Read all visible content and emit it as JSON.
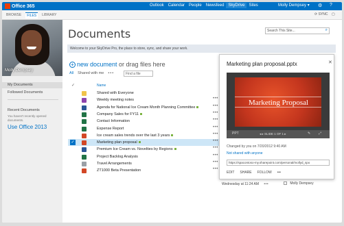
{
  "suite_bar": {
    "brand": "Office 365",
    "links": [
      "Outlook",
      "Calendar",
      "People",
      "Newsfeed",
      "SkyDrive",
      "Sites"
    ],
    "active_link": "SkyDrive",
    "user": "Molly Dempsey",
    "user_chevron": "▾",
    "gear_glyph": "⚙",
    "help_glyph": "?"
  },
  "ribbon": {
    "tabs": [
      "BROWSE",
      "FILES",
      "LIBRARY"
    ],
    "selected_tab": "FILES",
    "sync": "SYNC",
    "focus_glyph": "▢"
  },
  "profile": {
    "name": "Molly Dempsey"
  },
  "left_nav": {
    "items": [
      "My Documents",
      "Followed Documents"
    ],
    "recent_heading": "Recent Documents",
    "recent_note": "You haven't recently opened documents.",
    "use_office": "Use Office 2013"
  },
  "page": {
    "title": "Documents",
    "search_placeholder": "Search This Site...",
    "search_glyph": "⌕",
    "welcome": "Welcome to your SkyDrive Pro, the place to store, sync, and share your work."
  },
  "library": {
    "new_document": "new document",
    "new_document_rest": " or drag files here",
    "plus_glyph": "+",
    "filters": {
      "all": "All",
      "shared": "Shared with me",
      "more": "•••"
    },
    "find_placeholder": "Find a file",
    "header_check": "✓",
    "header_name": "Name",
    "check_glyph": "✓",
    "ellipsis": "•••",
    "files": [
      {
        "name": "Shared with Everyone",
        "type": "folder",
        "shared": false,
        "selected": false
      },
      {
        "name": "Weekly meeting notes",
        "type": "onenote",
        "shared": false,
        "selected": false
      },
      {
        "name": "Agenda for National Ice Cream Month Planning Committee",
        "type": "word",
        "shared": true,
        "selected": false
      },
      {
        "name": "Company Sales for FY11",
        "type": "excel",
        "shared": true,
        "selected": false
      },
      {
        "name": "Contact Information",
        "type": "excel",
        "shared": false,
        "selected": false
      },
      {
        "name": "Expense Report",
        "type": "excel",
        "shared": false,
        "selected": false
      },
      {
        "name": "Ice cream sales trends over the last 3 years",
        "type": "ppt",
        "shared": true,
        "selected": false
      },
      {
        "name": "Marketing plan proposal",
        "type": "ppt",
        "shared": true,
        "selected": true
      },
      {
        "name": "Premium Ice Cream vs. Novelties by Regions",
        "type": "word",
        "shared": true,
        "selected": false
      },
      {
        "name": "Project Backlog Analysis",
        "type": "excel",
        "shared": false,
        "selected": false
      },
      {
        "name": "Travel Arrangements",
        "type": "gen",
        "shared": false,
        "selected": false
      },
      {
        "name": "ZT1000 Beta Presentation",
        "type": "ppt",
        "shared": false,
        "selected": false
      }
    ]
  },
  "callout": {
    "title": "Marketing plan proposal.pptx",
    "close_glyph": "✕",
    "slide_title": "Marketing Proposal",
    "player_nav": "◂ ▸  SLIDE 1 OF 1  ▸",
    "player_left": "PPT",
    "player_edit": "✎",
    "player_full": "⤢",
    "changed": "Changed by you on 7/20/2012 9:40 AM",
    "not_shared": "Not shared with anyone",
    "url": "https://spacontoso-my.sharepoint.com/personal/mollyd_spo",
    "actions": [
      "EDIT",
      "SHARE",
      "FOLLOW",
      "•••"
    ]
  },
  "below_row": {
    "text": "Wednesday at 11:24 AM",
    "ellipsis": "•••",
    "user": "Molly Dempsey"
  }
}
